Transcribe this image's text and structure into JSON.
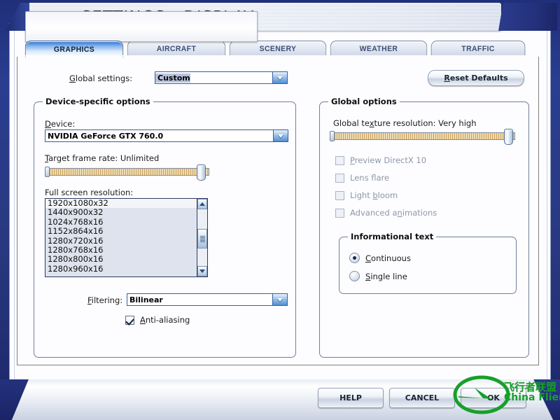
{
  "window": {
    "title": "SETTINGS - DISPLAY"
  },
  "tabs": [
    {
      "label": "GRAPHICS",
      "active": true
    },
    {
      "label": "AIRCRAFT",
      "active": false
    },
    {
      "label": "SCENERY",
      "active": false
    },
    {
      "label": "WEATHER",
      "active": false
    },
    {
      "label": "TRAFFIC",
      "active": false
    }
  ],
  "toolbar": {
    "global_settings_label": "Global settings:",
    "global_settings_value": "Custom",
    "reset_defaults_label": "Reset Defaults"
  },
  "device_group": {
    "title": "Device-specific options",
    "device_label": "Device:",
    "device_value": "NVIDIA GeForce GTX 760.0",
    "target_frame_rate_label": "Target frame rate: Unlimited",
    "target_frame_rate_percent": 97,
    "resolution_label": "Full screen resolution:",
    "resolutions": [
      "1920x1080x32",
      "1440x900x32",
      "1024x768x16",
      "1152x864x16",
      "1280x720x16",
      "1280x768x16",
      "1280x800x16",
      "1280x960x16"
    ],
    "selected_resolution_index": 0,
    "filtering_label": "Filtering:",
    "filtering_value": "Bilinear",
    "antialiasing_label": "Anti-aliasing",
    "antialiasing_checked": true
  },
  "global_group": {
    "title": "Global options",
    "texture_resolution_label": "Global texture resolution: Very high",
    "texture_resolution_percent": 98,
    "checkboxes": [
      {
        "label": "Preview DirectX 10",
        "checked": false,
        "disabled": true
      },
      {
        "label": "Lens flare",
        "checked": false,
        "disabled": true
      },
      {
        "label": "Light bloom",
        "checked": false,
        "disabled": true
      },
      {
        "label": "Advanced animations",
        "checked": false,
        "disabled": true
      }
    ],
    "info_text_group": {
      "title": "Informational text",
      "options": [
        {
          "label": "Continuous",
          "selected": true
        },
        {
          "label": "Single line",
          "selected": false
        }
      ]
    }
  },
  "footer": {
    "help_label": "HELP",
    "cancel_label": "CANCEL",
    "ok_label": "OK"
  },
  "watermark": {
    "chinese": "飞行者联盟",
    "english": "China Flier",
    "color": "#17a02a"
  }
}
